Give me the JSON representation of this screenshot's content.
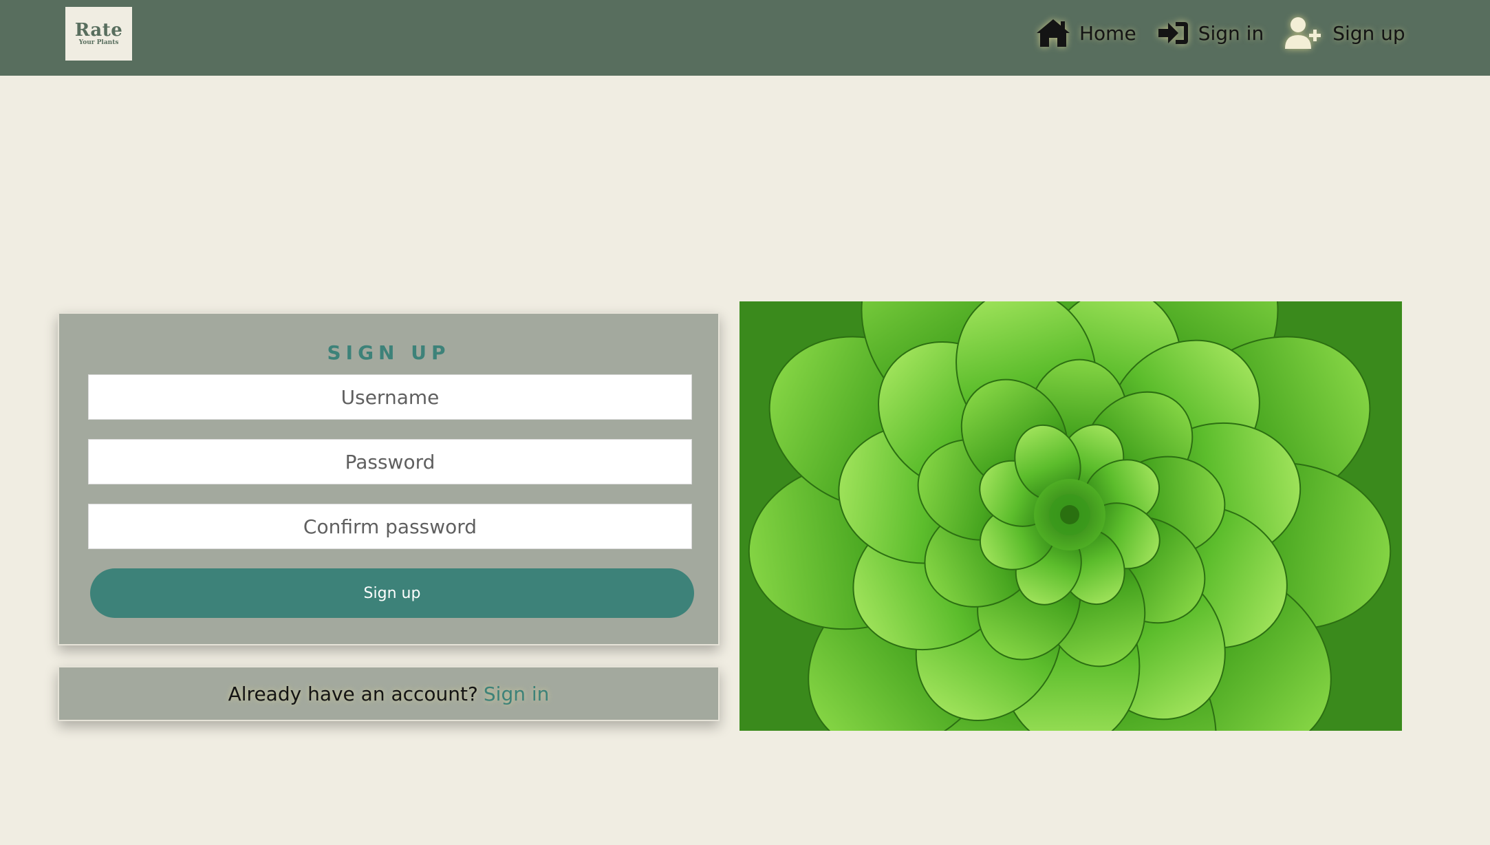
{
  "header": {
    "logo": {
      "title": "Rate",
      "subtitle": "Your Plants"
    },
    "nav": [
      {
        "label": "Home",
        "icon": "home-icon"
      },
      {
        "label": "Sign in",
        "icon": "sign-in-icon"
      },
      {
        "label": "Sign up",
        "icon": "user-plus-icon"
      }
    ]
  },
  "signup_form": {
    "title": "SIGN UP",
    "username_placeholder": "Username",
    "password_placeholder": "Password",
    "confirm_placeholder": "Confirm password",
    "submit_label": "Sign up"
  },
  "signin_prompt": {
    "text": "Already have an account?",
    "link_label": "Sign in"
  },
  "image": {
    "subject": "succulent-rosette"
  },
  "colors": {
    "navbar": "#586e5e",
    "background": "#f0ede2",
    "card": "#a3a99e",
    "accent": "#3d8279"
  }
}
